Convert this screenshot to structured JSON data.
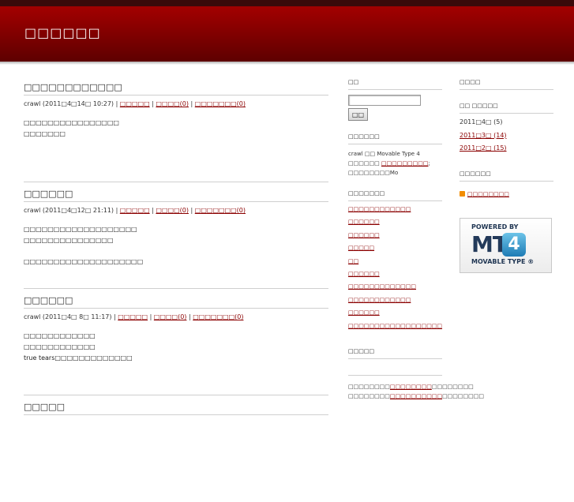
{
  "site": {
    "title": "□□□□□□"
  },
  "entries": [
    {
      "title": "□□□□□□□□□□□□",
      "meta_prefix": "crawl (2011□4□14□ 10:27) | ",
      "link1": "□□□□□",
      "link2": "□□□□(0)",
      "link3": "□□□□□□□(0)",
      "lines": [
        "□□□□□□□□□□□□□□□□",
        "□□□□□□□"
      ],
      "extra": ""
    },
    {
      "title": "□□□□□□",
      "meta_prefix": "crawl (2011□4□12□ 21:11) | ",
      "link1": "□□□□□",
      "link2": "□□□□(0)",
      "link3": "□□□□□□□(0)",
      "lines": [
        "□□□□□□□□□□□□□□□□□□□",
        "□□□□□□□□□□□□□□□"
      ],
      "extra": "□□□□□□□□□□□□□□□□□□□□"
    },
    {
      "title": "□□□□□□",
      "meta_prefix": "crawl (2011□4□ 8□ 11:17) | ",
      "link1": "□□□□□",
      "link2": "□□□□(0)",
      "link3": "□□□□□□□(0)",
      "lines": [
        "□□□□□□□□□□□□",
        "□□□□□□□□□□□□",
        "true tears□□□□□□□□□□□□□"
      ],
      "extra": ""
    },
    {
      "title": "□□□□□",
      "meta_prefix": "",
      "link1": "",
      "link2": "",
      "link3": "",
      "lines": [],
      "extra": ""
    }
  ],
  "col2": {
    "search": {
      "title": "□□",
      "button": "□□",
      "value": ""
    },
    "about": {
      "title": "□□□□□□",
      "text": "crawl □□ Movable Type 4 □□□□□□ ",
      "link": "□□□□□□□□□",
      "tail": "; □□□□□□□□Mo"
    },
    "categories": {
      "title": "□□□□□□□",
      "items": [
        "□□□□□□□□□□□□",
        "□□□□□□",
        "□□□□□□",
        "□□□□□",
        "□□",
        "□□□□□□",
        "□□□□□□□□□□□□□",
        "□□□□□□□□□□□□",
        "□□□□□□",
        "□□□□□□□□□□□□□□□□□□"
      ]
    },
    "recent": {
      "title": "□□□□□",
      "line1_pre": "□□□□□□□□",
      "line1_link": "□□□□□□□□",
      "line1_post": "□□□□□□□□",
      "line2_pre": "□□□□□□□□",
      "line2_link": "□□□□□□□□□□",
      "line2_post": "□□□□□□□□"
    }
  },
  "col3": {
    "calendar_title": "□□□□",
    "archives": {
      "title": "□□ □□□□□",
      "items": [
        "2011□4□ (5)",
        "2011□3□ (14)",
        "2011□2□ (15)"
      ]
    },
    "feed": {
      "title": "□□□□□□",
      "link": "□□□□□□□□"
    },
    "badge": {
      "top": "POWERED BY",
      "mt": "MT",
      "num": "4",
      "bottom": "MOVABLE TYPE ®"
    }
  }
}
